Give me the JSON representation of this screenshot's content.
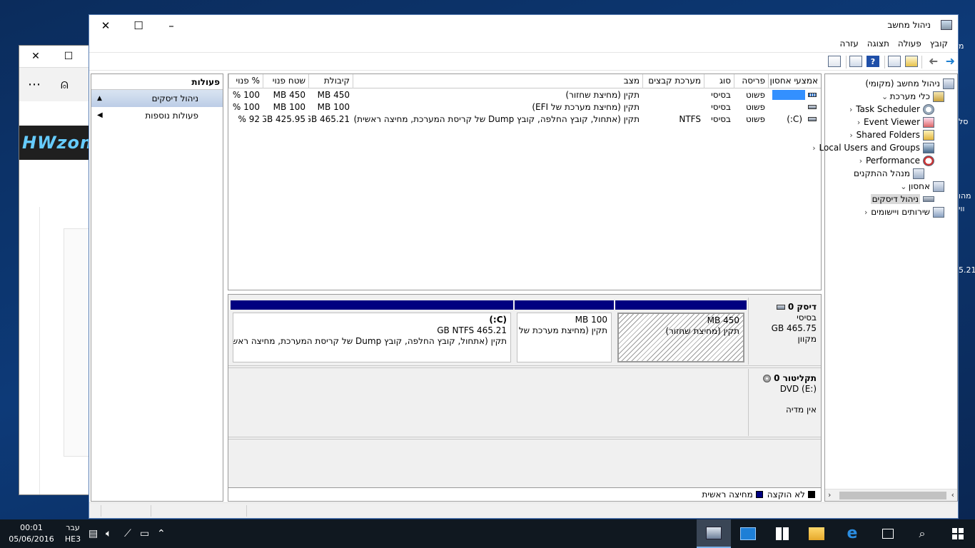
{
  "main_window": {
    "title": "ניהול מחשב",
    "menus": [
      "קובץ",
      "פעולה",
      "תצוגה",
      "עזרה"
    ]
  },
  "tree": {
    "items": [
      {
        "label": "ניהול מחשב (מקומי)",
        "icon": "computer-management-icon",
        "expander": ""
      },
      {
        "label": "כלי מערכת",
        "icon": "system-tools-icon",
        "expander": "⌄"
      },
      {
        "label": "Task Scheduler",
        "icon": "clock-icon",
        "expander": "‹"
      },
      {
        "label": "Event Viewer",
        "icon": "event-viewer-icon",
        "expander": "‹"
      },
      {
        "label": "Shared Folders",
        "icon": "shared-folders-icon",
        "expander": "‹"
      },
      {
        "label": "Local Users and Groups",
        "icon": "users-icon",
        "expander": "‹"
      },
      {
        "label": "Performance",
        "icon": "performance-icon",
        "expander": "‹"
      },
      {
        "label": "מנהל ההתקנים",
        "icon": "device-manager-icon",
        "expander": ""
      },
      {
        "label": "אחסון",
        "icon": "storage-icon",
        "expander": "⌄"
      },
      {
        "label": "ניהול דיסקים",
        "icon": "disk-management-icon",
        "expander": ""
      },
      {
        "label": "שירותים ויישומים",
        "icon": "services-icon",
        "expander": "‹"
      }
    ]
  },
  "volumes": {
    "columns": [
      "אמצעי אחסון",
      "פריסה",
      "סוג",
      "מערכת קבצים",
      "מצב",
      "קיבולת",
      "שטח פנוי",
      "% פנוי"
    ],
    "rows": [
      {
        "volume": "",
        "layout": "פשוט",
        "type": "בסיסי",
        "fs": "",
        "status": "תקין (מחיצת שחזור)",
        "capacity": "450 MB",
        "free": "450 MB",
        "pct": "100 %"
      },
      {
        "volume": "",
        "layout": "פשוט",
        "type": "בסיסי",
        "fs": "",
        "status": "תקין (מחיצת מערכת של EFI)",
        "capacity": "100 MB",
        "free": "100 MB",
        "pct": "100 %"
      },
      {
        "volume": "(C:)",
        "layout": "פשוט",
        "type": "בסיסי",
        "fs": "NTFS",
        "status": "תקין (אתחול, קובץ החלפה, קובץ Dump של קריסת המערכת, מחיצה ראשית)",
        "capacity": "465.21 GB",
        "free": "425.95 GB",
        "pct": "92 %"
      }
    ]
  },
  "disks": [
    {
      "name": "דיסק 0",
      "type": "בסיסי",
      "size": "465.75 GB",
      "state": "מקוון",
      "partitions": [
        {
          "title": "",
          "size": "450 MB",
          "status": "תקין (מחיצת שחזור)"
        },
        {
          "title": "",
          "size": "100 MB",
          "status": "תקין (מחיצת מערכת של"
        },
        {
          "title": "(C:)",
          "size": "465.21 GB NTFS",
          "status": "תקין (אתחול, קובץ החלפה, קובץ Dump של קריסת המערכת, מחיצה ראשי"
        }
      ]
    },
    {
      "name": "תקליטור 0",
      "type": "DVD (E:)",
      "state": "אין מדיה"
    }
  ],
  "legend": [
    {
      "label": "לא הוקצה",
      "color": "#000000"
    },
    {
      "label": "מחיצה ראשית",
      "color": "#000080"
    }
  ],
  "actions": {
    "header": "פעולות",
    "selected": "ניהול דיסקים",
    "more": "פעולות נוספות"
  },
  "taskbar": {
    "time": "00:01",
    "date": "05/06/2016",
    "lang_top": "עבר",
    "lang_bottom": "HE3"
  },
  "background_window": {
    "logo_text": "HWzon"
  },
  "desktop_right_texts": [
    "מ",
    "סל",
    "מהו",
    "ווי",
    "5.21"
  ]
}
